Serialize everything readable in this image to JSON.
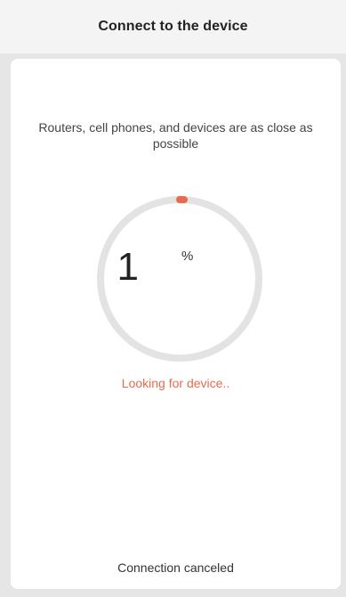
{
  "header": {
    "title": "Connect to the device"
  },
  "card": {
    "instruction": "Routers, cell phones, and devices are as close as possible",
    "progress": {
      "value": 1,
      "unit": "%"
    },
    "status": "Looking for device..",
    "cancel_label": "Connection canceled"
  },
  "colors": {
    "accent": "#e86b4f",
    "ring_track": "#e3e3e3",
    "background": "#e6e6e6",
    "card": "#ffffff"
  }
}
